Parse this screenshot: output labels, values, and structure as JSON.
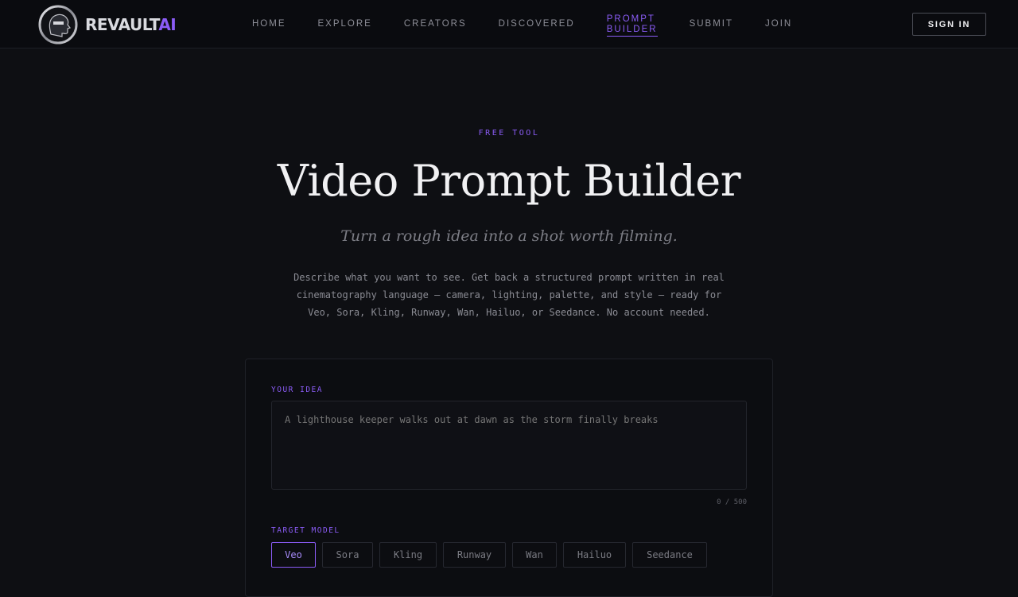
{
  "nav": {
    "brand": "REVAULT",
    "brand_suffix": "AI",
    "links": [
      {
        "label": "HOME"
      },
      {
        "label": "EXPLORE"
      },
      {
        "label": "CREATORS"
      },
      {
        "label": "DISCOVERED"
      },
      {
        "label_line1": "PROMPT",
        "label_line2": "BUILDER",
        "active": true
      },
      {
        "label": "SUBMIT"
      },
      {
        "label": "JOIN"
      }
    ],
    "sign_in": "SIGN IN"
  },
  "hero": {
    "eyebrow": "FREE TOOL",
    "title": "Video Prompt Builder",
    "subtitle": "Turn a rough idea into a shot worth filming.",
    "description": "Describe what you want to see. Get back a structured prompt written in real cinematography language — camera, lighting, palette, and style — ready for Veo, Sora, Kling, Runway, Wan, Hailuo, or Seedance. No account needed."
  },
  "form": {
    "idea_label": "YOUR IDEA",
    "idea_placeholder": "A lighthouse keeper walks out at dawn as the storm finally breaks",
    "idea_value": "",
    "counter": "0 / 500",
    "model_label": "TARGET MODEL",
    "models": [
      "Veo",
      "Sora",
      "Kling",
      "Runway",
      "Wan",
      "Hailuo",
      "Seedance"
    ],
    "selected_model": "Veo"
  },
  "colors": {
    "accent": "#8b5cf6",
    "background": "#0e0f13",
    "nav_background": "#0a0b0f"
  }
}
